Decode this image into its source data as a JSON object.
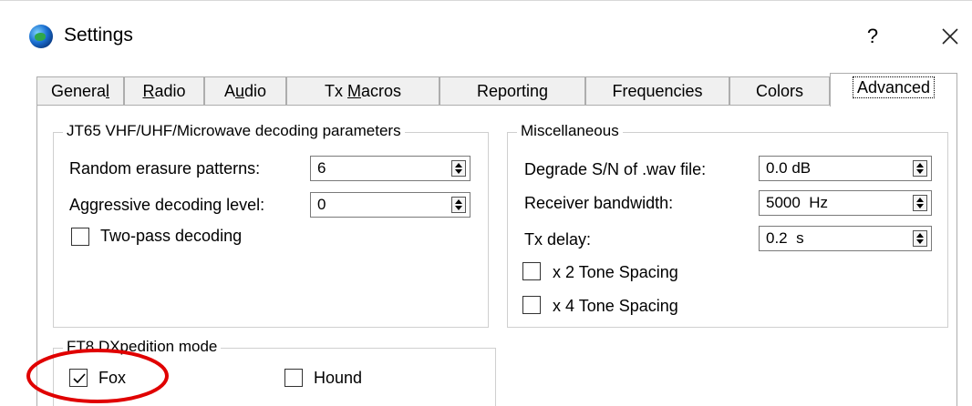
{
  "window": {
    "title": "Settings",
    "help_label": "?",
    "app_icon": "globe-icon",
    "close_icon": "close-icon"
  },
  "tabs": [
    {
      "label": "General",
      "underline": "l",
      "before": "Genera",
      "after": ""
    },
    {
      "label": "Radio",
      "before": "",
      "underline": "R",
      "after": "adio"
    },
    {
      "label": "Audio",
      "before": "A",
      "underline": "u",
      "after": "dio"
    },
    {
      "label": "Tx Macros",
      "before": "Tx ",
      "underline": "M",
      "after": "acros"
    },
    {
      "label": "Reporting",
      "before": "Reportin",
      "underline": "g",
      "after": ""
    },
    {
      "label": "Frequencies",
      "before": "Frequencies",
      "underline": "",
      "after": ""
    },
    {
      "label": "Colors",
      "before": "Colors",
      "underline": "",
      "after": ""
    },
    {
      "label": "Advanced",
      "before": "Advanced",
      "underline": "",
      "after": "",
      "active": true
    }
  ],
  "jt65": {
    "title": "JT65 VHF/UHF/Microwave decoding parameters",
    "random_erasure_label": "Random erasure patterns:",
    "random_erasure_value": "6",
    "aggressive_label": "Aggressive decoding level:",
    "aggressive_value": "0",
    "two_pass_label": "Two-pass decoding",
    "two_pass_checked": false
  },
  "misc": {
    "title": "Miscellaneous",
    "degrade_label": "Degrade S/N of .wav file:",
    "degrade_value": "0.0 dB",
    "bandwidth_label": "Receiver bandwidth:",
    "bandwidth_value": "5000  Hz",
    "txdelay_label": "Tx delay:",
    "txdelay_value": "0.2  s",
    "x2_label": "x 2 Tone Spacing",
    "x2_checked": false,
    "x4_label": "x 4 Tone Spacing",
    "x4_checked": false
  },
  "ft8": {
    "title": "FT8 DXpedition mode",
    "fox_label": "Fox",
    "fox_checked": true,
    "hound_label": "Hound",
    "hound_checked": false
  },
  "colors": {
    "annotation": "#e00000",
    "active_tab_bg": "#ffffff",
    "inactive_tab_bg": "#f0f0f0"
  }
}
